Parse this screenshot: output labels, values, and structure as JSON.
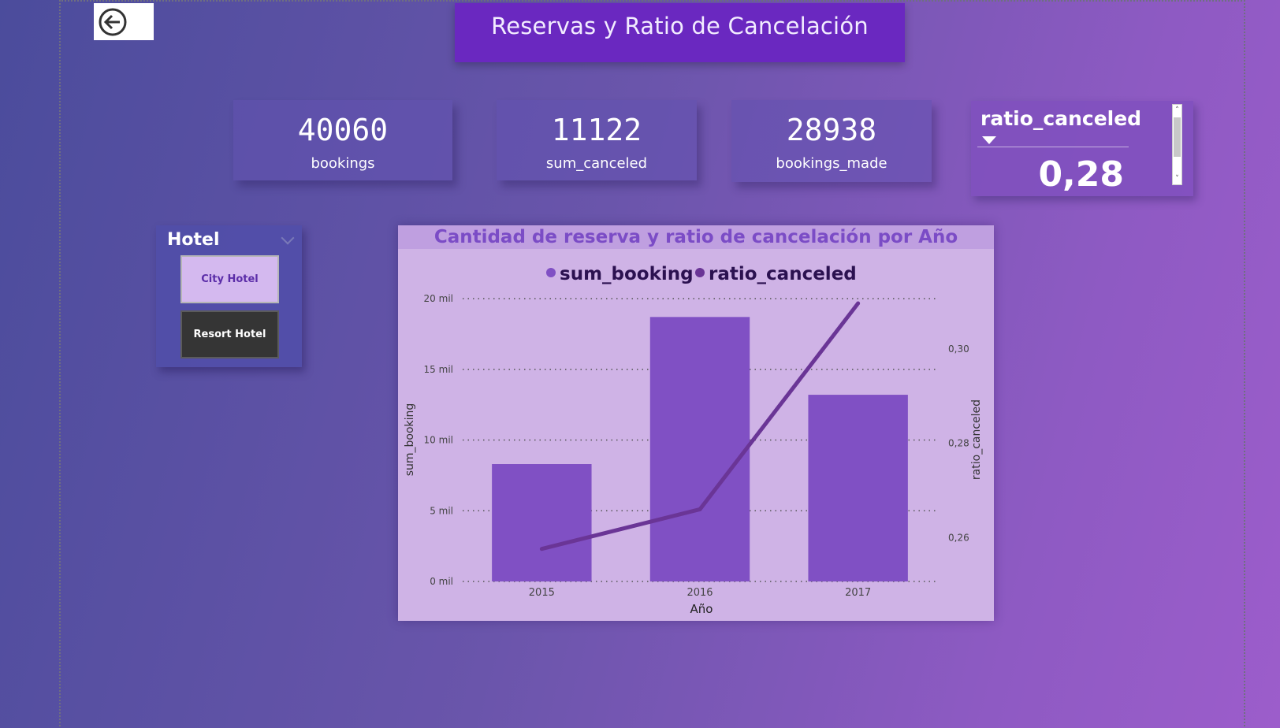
{
  "page": {
    "title": "Reservas y Ratio de Cancelación",
    "back_icon": "back-arrow-icon"
  },
  "kpis": [
    {
      "value": "40060",
      "label": "bookings"
    },
    {
      "value": "11122",
      "label": "sum_canceled"
    },
    {
      "value": "28938",
      "label": "bookings_made"
    }
  ],
  "ratio_card": {
    "label": "ratio_canceled",
    "value": "0,28"
  },
  "slicer": {
    "title": "Hotel",
    "options": [
      "City Hotel",
      "Resort Hotel"
    ],
    "selected": "City Hotel"
  },
  "colors": {
    "bar": "#8050c4",
    "line": "#6a3596",
    "chart_bg": "#cfb3e6",
    "title_bg": "#6a28c0"
  },
  "chart_data": {
    "type": "bar",
    "title": "Cantidad de reserva y ratio de cancelación por Año",
    "categories": [
      "2015",
      "2016",
      "2017"
    ],
    "xlabel": "Año",
    "ylabel": "sum_booking",
    "y2label": "ratio_canceled",
    "legend_position": "top-center",
    "grid": true,
    "series": [
      {
        "name": "sum_booking",
        "type": "bar",
        "axis": "left",
        "values": [
          8300,
          18700,
          13200
        ]
      },
      {
        "name": "ratio_canceled",
        "type": "line",
        "axis": "right",
        "values": [
          0.2576,
          0.266,
          0.3097
        ]
      }
    ],
    "y_ticks": [
      "0 mil",
      "5 mil",
      "10 mil",
      "15 mil",
      "20 mil"
    ],
    "y_tick_values": [
      0,
      5000,
      10000,
      15000,
      20000
    ],
    "ylim": [
      0,
      20000
    ],
    "y2_ticks": [
      "0,26",
      "0,28",
      "0,30"
    ],
    "y2_tick_values": [
      0.26,
      0.28,
      0.3
    ],
    "y2lim": [
      0.2507,
      0.3107
    ]
  }
}
